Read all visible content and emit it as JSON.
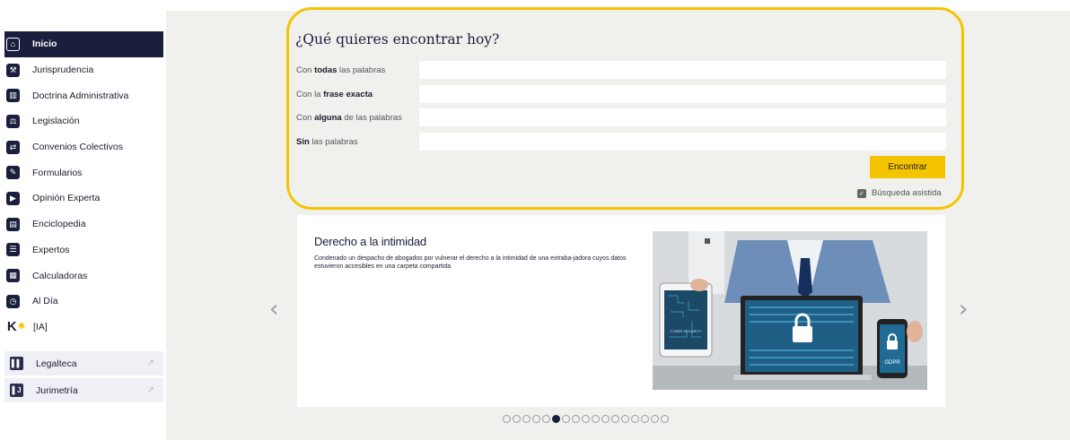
{
  "sidebar": {
    "items": [
      {
        "label": "Inicio",
        "icon": "home-icon",
        "glyph": "⌂",
        "active": true
      },
      {
        "label": "Jurisprudencia",
        "icon": "gavel-icon",
        "glyph": "⚒"
      },
      {
        "label": "Doctrina Administrativa",
        "icon": "institution-icon",
        "glyph": "▥"
      },
      {
        "label": "Legislación",
        "icon": "scales-icon",
        "glyph": "⚖"
      },
      {
        "label": "Convenios Colectivos",
        "icon": "handshake-icon",
        "glyph": "⇄"
      },
      {
        "label": "Formularios",
        "icon": "form-edit-icon",
        "glyph": "✎"
      },
      {
        "label": "Opinión Experta",
        "icon": "play-doc-icon",
        "glyph": "▶"
      },
      {
        "label": "Enciclopedia",
        "icon": "book-icon",
        "glyph": "▤"
      },
      {
        "label": "Expertos",
        "icon": "list-icon",
        "glyph": "☰"
      },
      {
        "label": "Calculadoras",
        "icon": "calculator-icon",
        "glyph": "▦"
      },
      {
        "label": "Al Día",
        "icon": "clock-icon",
        "glyph": "◷"
      },
      {
        "label": "[IA]",
        "icon": "k-ai-logo-icon",
        "glyph": "K"
      }
    ],
    "external": [
      {
        "label": "Legalteca",
        "icon": "legalteca-icon",
        "glyph": "▌▌",
        "arrow": "↗"
      },
      {
        "label": "Jurimetría",
        "icon": "jurimetria-icon",
        "glyph": "▌J",
        "arrow": "↗"
      }
    ]
  },
  "search": {
    "title": "¿Qué quieres encontrar hoy?",
    "fields": [
      {
        "pre": "Con ",
        "bold": "todas",
        "post": " las palabras",
        "value": ""
      },
      {
        "pre": "Con la ",
        "bold": "frase exacta",
        "post": "",
        "value": ""
      },
      {
        "pre": "Con ",
        "bold": "alguna",
        "post": " de las palabras",
        "value": ""
      },
      {
        "pre": "",
        "bold": "Sin",
        "post": " las palabras",
        "value": ""
      }
    ],
    "button_label": "Encontrar",
    "assisted_label": "Búsqueda asistida",
    "assisted_checked": true
  },
  "carousel": {
    "slide_title": "Derecho a la intimidad",
    "slide_text": "Condenado un despacho de abogados por vulnerar el derecho a la intimidad de una extraba-jadora cuyos datos estuvieron accesibles en una carpeta compartida",
    "image_labels": {
      "tablet": "CYBER SECURITY",
      "phone": "GDPR"
    },
    "prev_glyph": "‹",
    "next_glyph": "›",
    "dot_count": 17,
    "active_dot": 5
  },
  "colors": {
    "accent": "#f5c400",
    "navy": "#1b1e3d",
    "background": "#f0f0ed"
  }
}
